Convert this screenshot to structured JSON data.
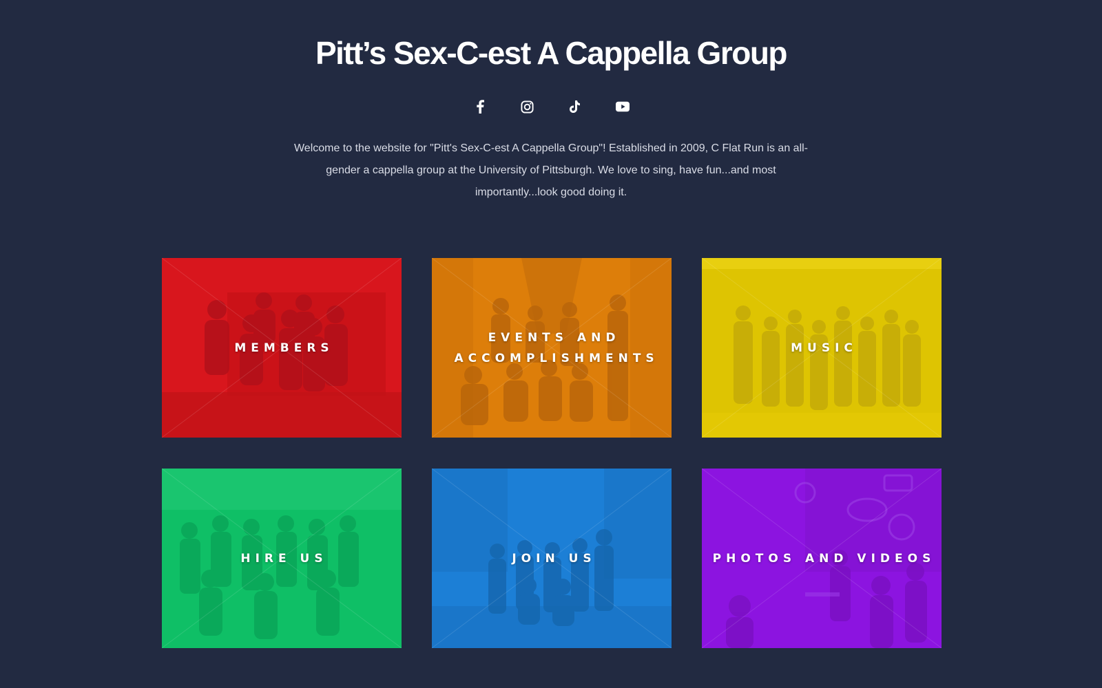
{
  "header": {
    "title": "Pitt’s Sex-C-est A Cappella Group"
  },
  "social": [
    {
      "icon": "facebook-icon",
      "label": "Facebook"
    },
    {
      "icon": "instagram-icon",
      "label": "Instagram"
    },
    {
      "icon": "tiktok-icon",
      "label": "TikTok"
    },
    {
      "icon": "youtube-icon",
      "label": "YouTube"
    }
  ],
  "intro": {
    "text": "Welcome to the website for \"Pitt's Sex-C-est A Cappella Group\"! Established in 2009, C Flat Run is an all-gender a cappella group at the University of Pittsburgh. We love to sing, have fun...and most importantly...look good doing it."
  },
  "tiles": [
    {
      "label": "MEMBERS",
      "color": "#d8161d"
    },
    {
      "label": "EVENTS AND ACCOMPLISHMENTS",
      "color": "#dd7e0a"
    },
    {
      "label": "MUSIC",
      "color": "#dec402"
    },
    {
      "label": "HIRE US",
      "color": "#0fbf66"
    },
    {
      "label": "JOIN US",
      "color": "#1c7fd6"
    },
    {
      "label": "PHOTOS AND VIDEOS",
      "color": "#8c14e0"
    }
  ],
  "colors": {
    "background": "#222a41",
    "text": "#ffffff",
    "intro_text": "#d9dce6"
  }
}
